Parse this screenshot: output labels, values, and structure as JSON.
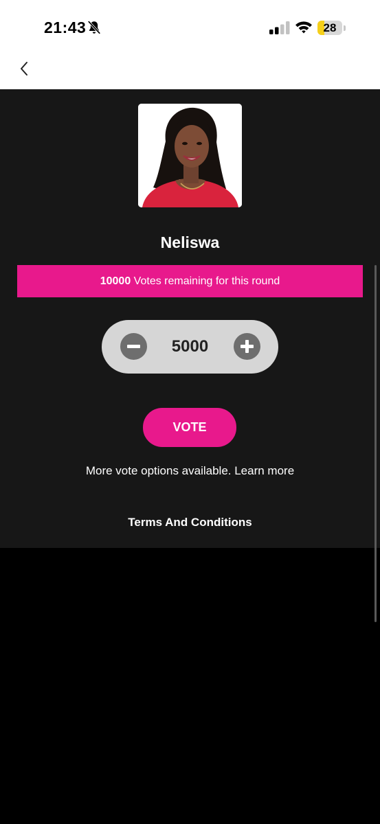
{
  "status_bar": {
    "time": "21:43",
    "battery_level": "28",
    "battery_fraction": 0.28,
    "icons": [
      "bell-slash-icon",
      "signal-icon",
      "wifi-icon",
      "battery-icon"
    ]
  },
  "nav": {
    "back_icon": "chevron-left-icon"
  },
  "contestant": {
    "name": "Neliswa",
    "photo_icon": "contestant-photo"
  },
  "votes_banner": {
    "count": "10000",
    "text": " Votes remaining for this round"
  },
  "stepper": {
    "value": "5000",
    "minus_icon": "minus-icon",
    "plus_icon": "plus-icon"
  },
  "vote_button": {
    "label": "VOTE"
  },
  "more_options_text": "More vote options available. Learn more",
  "terms_label": "Terms And Conditions",
  "colors": {
    "accent": "#e8198c",
    "panel": "#171717",
    "background": "#000000",
    "stepper_bg": "#d6d6d6",
    "stepper_button": "#6e6e6e",
    "battery_fill": "#f5cf1a"
  }
}
